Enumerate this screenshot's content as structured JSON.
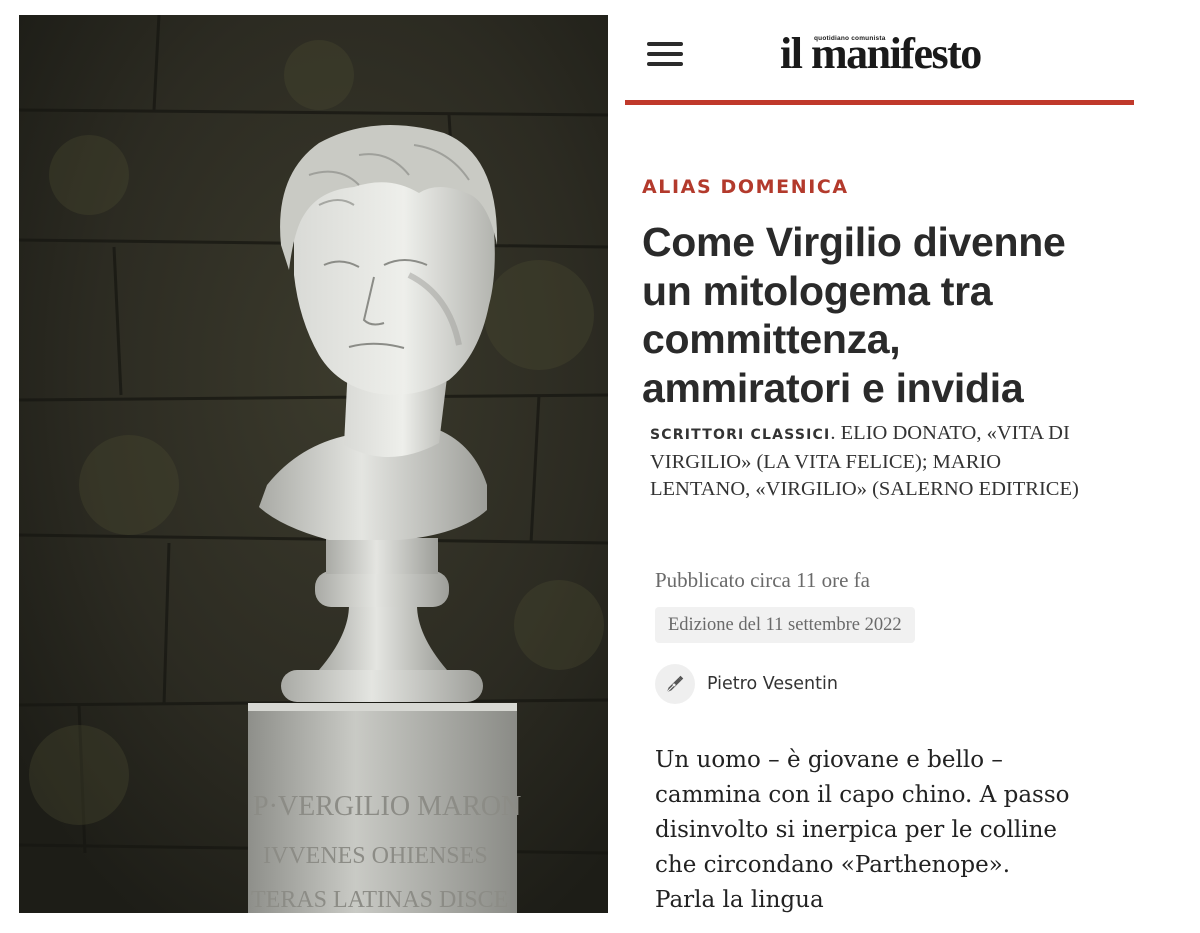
{
  "photo": {
    "alt": "",
    "inscription_lines": [
      "P·VERGILIO MARON",
      "IVVENES OHIENSES",
      "TERAS LATINAS DISCE"
    ]
  },
  "header": {
    "menu_icon": "hamburger-menu-icon",
    "logo_main": "il manifesto",
    "logo_tagline": "quotidiano comunista",
    "accent_color": "#c0392b"
  },
  "article": {
    "section": "ALIAS DOMENICA",
    "headline": "Come Virgilio divenne un mitologema tra committenza, ammiratori e invidia",
    "subtitle_kicker": "SCRITTORI CLASSICI",
    "subtitle_rest": ". ELIO DONATO, «VITA DI VIRGILIO» (LA VITA FELICE); MARIO LENTANO, «VIRGILIO» (SALERNO EDITRICE)",
    "published": "Pubblicato circa 11 ore fa",
    "edition": "Edizione del 11 settembre 2022",
    "author_icon": "pen-nib-icon",
    "author": "Pietro Vesentin",
    "body": "Un uomo – è giovane e bello – cammina con il capo chino. A passo disinvolto si inerpica per le colline che circondano «Parthenope». Parla la lingua"
  }
}
